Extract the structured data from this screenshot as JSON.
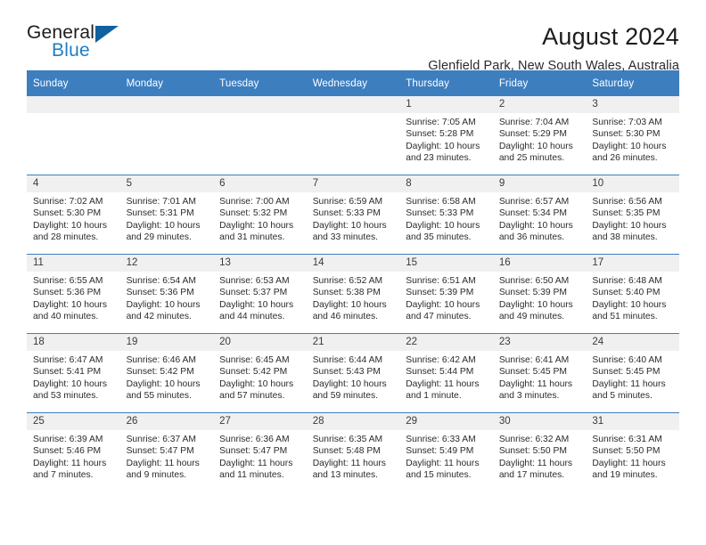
{
  "brand": {
    "name_top": "General",
    "name_bottom": "Blue",
    "triangle_color": "#11619e",
    "blue_color": "#1f7ec4"
  },
  "header": {
    "title": "August 2024",
    "location": "Glenfield Park, New South Wales, Australia"
  },
  "theme": {
    "header_row_bg": "#3d7ebf",
    "daynum_bg": "#f0f0f0",
    "text": "#2b2b2b"
  },
  "weekday_headers": [
    "Sunday",
    "Monday",
    "Tuesday",
    "Wednesday",
    "Thursday",
    "Friday",
    "Saturday"
  ],
  "labels": {
    "sunrise_prefix": "Sunrise: ",
    "sunset_prefix": "Sunset: ",
    "daylight_prefix": "Daylight: "
  },
  "weeks": [
    [
      {
        "day": "",
        "sunrise": "",
        "sunset": "",
        "daylight": "",
        "blank": true
      },
      {
        "day": "",
        "sunrise": "",
        "sunset": "",
        "daylight": "",
        "blank": true
      },
      {
        "day": "",
        "sunrise": "",
        "sunset": "",
        "daylight": "",
        "blank": true
      },
      {
        "day": "",
        "sunrise": "",
        "sunset": "",
        "daylight": "",
        "blank": true
      },
      {
        "day": "1",
        "sunrise": "Sunrise: 7:05 AM",
        "sunset": "Sunset: 5:28 PM",
        "daylight": "Daylight: 10 hours and 23 minutes."
      },
      {
        "day": "2",
        "sunrise": "Sunrise: 7:04 AM",
        "sunset": "Sunset: 5:29 PM",
        "daylight": "Daylight: 10 hours and 25 minutes."
      },
      {
        "day": "3",
        "sunrise": "Sunrise: 7:03 AM",
        "sunset": "Sunset: 5:30 PM",
        "daylight": "Daylight: 10 hours and 26 minutes."
      }
    ],
    [
      {
        "day": "4",
        "sunrise": "Sunrise: 7:02 AM",
        "sunset": "Sunset: 5:30 PM",
        "daylight": "Daylight: 10 hours and 28 minutes."
      },
      {
        "day": "5",
        "sunrise": "Sunrise: 7:01 AM",
        "sunset": "Sunset: 5:31 PM",
        "daylight": "Daylight: 10 hours and 29 minutes."
      },
      {
        "day": "6",
        "sunrise": "Sunrise: 7:00 AM",
        "sunset": "Sunset: 5:32 PM",
        "daylight": "Daylight: 10 hours and 31 minutes."
      },
      {
        "day": "7",
        "sunrise": "Sunrise: 6:59 AM",
        "sunset": "Sunset: 5:33 PM",
        "daylight": "Daylight: 10 hours and 33 minutes."
      },
      {
        "day": "8",
        "sunrise": "Sunrise: 6:58 AM",
        "sunset": "Sunset: 5:33 PM",
        "daylight": "Daylight: 10 hours and 35 minutes."
      },
      {
        "day": "9",
        "sunrise": "Sunrise: 6:57 AM",
        "sunset": "Sunset: 5:34 PM",
        "daylight": "Daylight: 10 hours and 36 minutes."
      },
      {
        "day": "10",
        "sunrise": "Sunrise: 6:56 AM",
        "sunset": "Sunset: 5:35 PM",
        "daylight": "Daylight: 10 hours and 38 minutes."
      }
    ],
    [
      {
        "day": "11",
        "sunrise": "Sunrise: 6:55 AM",
        "sunset": "Sunset: 5:36 PM",
        "daylight": "Daylight: 10 hours and 40 minutes."
      },
      {
        "day": "12",
        "sunrise": "Sunrise: 6:54 AM",
        "sunset": "Sunset: 5:36 PM",
        "daylight": "Daylight: 10 hours and 42 minutes."
      },
      {
        "day": "13",
        "sunrise": "Sunrise: 6:53 AM",
        "sunset": "Sunset: 5:37 PM",
        "daylight": "Daylight: 10 hours and 44 minutes."
      },
      {
        "day": "14",
        "sunrise": "Sunrise: 6:52 AM",
        "sunset": "Sunset: 5:38 PM",
        "daylight": "Daylight: 10 hours and 46 minutes."
      },
      {
        "day": "15",
        "sunrise": "Sunrise: 6:51 AM",
        "sunset": "Sunset: 5:39 PM",
        "daylight": "Daylight: 10 hours and 47 minutes."
      },
      {
        "day": "16",
        "sunrise": "Sunrise: 6:50 AM",
        "sunset": "Sunset: 5:39 PM",
        "daylight": "Daylight: 10 hours and 49 minutes."
      },
      {
        "day": "17",
        "sunrise": "Sunrise: 6:48 AM",
        "sunset": "Sunset: 5:40 PM",
        "daylight": "Daylight: 10 hours and 51 minutes."
      }
    ],
    [
      {
        "day": "18",
        "sunrise": "Sunrise: 6:47 AM",
        "sunset": "Sunset: 5:41 PM",
        "daylight": "Daylight: 10 hours and 53 minutes."
      },
      {
        "day": "19",
        "sunrise": "Sunrise: 6:46 AM",
        "sunset": "Sunset: 5:42 PM",
        "daylight": "Daylight: 10 hours and 55 minutes."
      },
      {
        "day": "20",
        "sunrise": "Sunrise: 6:45 AM",
        "sunset": "Sunset: 5:42 PM",
        "daylight": "Daylight: 10 hours and 57 minutes."
      },
      {
        "day": "21",
        "sunrise": "Sunrise: 6:44 AM",
        "sunset": "Sunset: 5:43 PM",
        "daylight": "Daylight: 10 hours and 59 minutes."
      },
      {
        "day": "22",
        "sunrise": "Sunrise: 6:42 AM",
        "sunset": "Sunset: 5:44 PM",
        "daylight": "Daylight: 11 hours and 1 minute."
      },
      {
        "day": "23",
        "sunrise": "Sunrise: 6:41 AM",
        "sunset": "Sunset: 5:45 PM",
        "daylight": "Daylight: 11 hours and 3 minutes."
      },
      {
        "day": "24",
        "sunrise": "Sunrise: 6:40 AM",
        "sunset": "Sunset: 5:45 PM",
        "daylight": "Daylight: 11 hours and 5 minutes."
      }
    ],
    [
      {
        "day": "25",
        "sunrise": "Sunrise: 6:39 AM",
        "sunset": "Sunset: 5:46 PM",
        "daylight": "Daylight: 11 hours and 7 minutes."
      },
      {
        "day": "26",
        "sunrise": "Sunrise: 6:37 AM",
        "sunset": "Sunset: 5:47 PM",
        "daylight": "Daylight: 11 hours and 9 minutes."
      },
      {
        "day": "27",
        "sunrise": "Sunrise: 6:36 AM",
        "sunset": "Sunset: 5:47 PM",
        "daylight": "Daylight: 11 hours and 11 minutes."
      },
      {
        "day": "28",
        "sunrise": "Sunrise: 6:35 AM",
        "sunset": "Sunset: 5:48 PM",
        "daylight": "Daylight: 11 hours and 13 minutes."
      },
      {
        "day": "29",
        "sunrise": "Sunrise: 6:33 AM",
        "sunset": "Sunset: 5:49 PM",
        "daylight": "Daylight: 11 hours and 15 minutes."
      },
      {
        "day": "30",
        "sunrise": "Sunrise: 6:32 AM",
        "sunset": "Sunset: 5:50 PM",
        "daylight": "Daylight: 11 hours and 17 minutes."
      },
      {
        "day": "31",
        "sunrise": "Sunrise: 6:31 AM",
        "sunset": "Sunset: 5:50 PM",
        "daylight": "Daylight: 11 hours and 19 minutes."
      }
    ]
  ]
}
